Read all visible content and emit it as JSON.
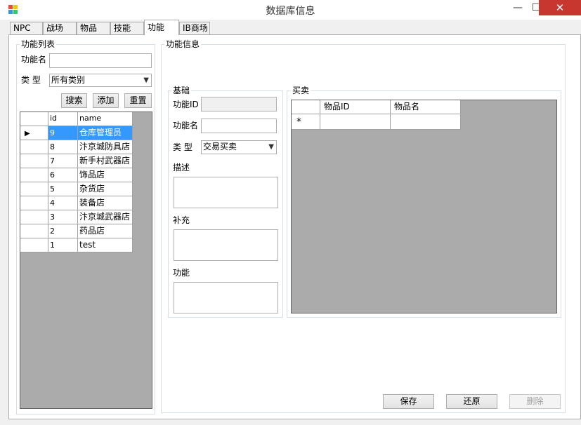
{
  "window": {
    "title": "数据库信息",
    "minimize": "—",
    "maximize": "☐",
    "close": "✕"
  },
  "tabs": [
    "NPC",
    "战场",
    "物品",
    "技能",
    "功能",
    "IB商场"
  ],
  "active_tab": "功能",
  "left_panel": {
    "group_title": "功能列表",
    "name_label": "功能名",
    "name_value": "",
    "type_label": "类 型",
    "type_value": "所有类别",
    "search_button": "搜索",
    "add_button": "添加",
    "reset_button": "重置",
    "columns": [
      "id",
      "name"
    ],
    "rows": [
      {
        "id": "9",
        "name": "仓库管理员",
        "selected": true
      },
      {
        "id": "8",
        "name": "汴京城防具店"
      },
      {
        "id": "7",
        "name": "新手村武器店"
      },
      {
        "id": "6",
        "name": "饰品店"
      },
      {
        "id": "5",
        "name": "杂货店"
      },
      {
        "id": "4",
        "name": "装备店"
      },
      {
        "id": "3",
        "name": "汴京城武器店"
      },
      {
        "id": "2",
        "name": "药品店"
      },
      {
        "id": "1",
        "name": "test"
      }
    ]
  },
  "right_panel": {
    "group_title": "功能信息",
    "basic": {
      "group_title": "基础",
      "id_label": "功能ID",
      "id_value": "",
      "name_label": "功能名",
      "name_value": "",
      "type_label": "类 型",
      "type_value": "交易买卖",
      "desc_label": "描述",
      "extra_label": "补充",
      "func_label": "功能"
    },
    "trade": {
      "group_title": "买卖",
      "columns": [
        "物品ID",
        "物品名"
      ],
      "new_row_marker": "*"
    },
    "save_button": "保存",
    "restore_button": "还原",
    "delete_button": "删除"
  },
  "colors": {
    "selection": "#3399ff",
    "grid_background": "#ababab",
    "close_button": "#c7372f"
  }
}
